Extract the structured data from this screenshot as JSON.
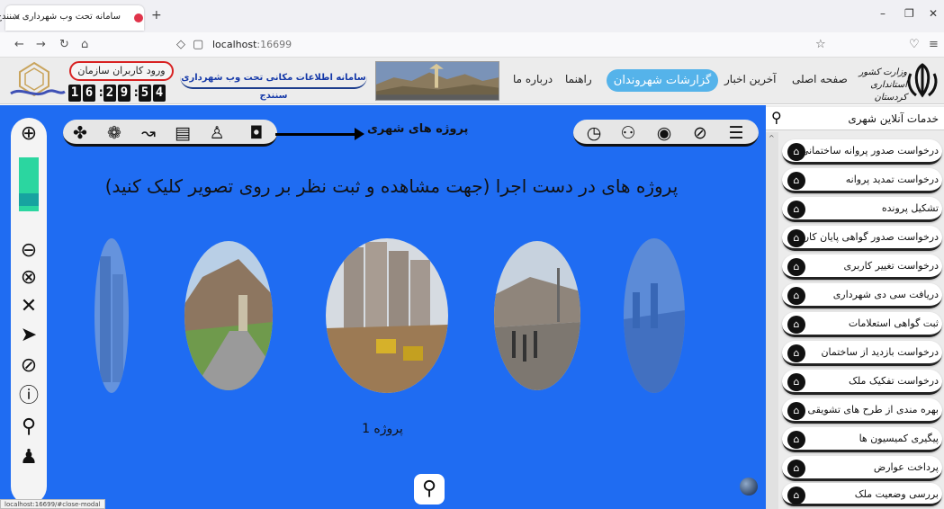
{
  "browser": {
    "tab_title": "سامانه تحت وب شهرداری سنندج",
    "tab_close": "×",
    "new_tab": "+",
    "url_host": "localhost",
    "url_port": ":16699",
    "win_min": "–",
    "win_max": "❐",
    "win_close": "✕"
  },
  "header": {
    "ministry": "وزارت کشور استانداری کردستان",
    "nav": {
      "home": "صفحه اصلی",
      "news": "آخرین اخبار",
      "reports": "گزارشات شهروندان",
      "guide": "راهنما",
      "about": "درباره ما"
    },
    "system_title": "سامانه اطلاعات مکانی تحت وب شهرداری سنندج",
    "login": "ورود کاربران سازمان",
    "clock": [
      "1",
      "6",
      ":",
      "2",
      "9",
      ":",
      "5",
      "4"
    ]
  },
  "main": {
    "projects_label": "پروژه های شهری",
    "headline": "پروژه های در دست اجرا (جهت مشاهده و ثبت نظر بر روی تصویر کلیک کنید)",
    "caption": "پروژه 1",
    "status_url": "localhost:16699/#close-modal"
  },
  "sidebar": {
    "title": "خدمات آنلاین شهری",
    "items": [
      "درخواست صدور پروانه ساختمانی",
      "درخواست تمدید پروانه",
      "تشکیل پرونده",
      "درخواست صدور گواهی پایان کار",
      "درخواست تغییر کاربری",
      "دریافت سی دی شهرداری",
      "ثبت گواهی استعلامات",
      "درخواست بازدید از ساختمان",
      "درخواست تفکیک ملک",
      "بهره مندی از طرح های تشویقی",
      "پیگیری کمیسیون ها",
      "پرداخت عوارض",
      "بررسی وضعیت ملک"
    ]
  },
  "colors": {
    "main_blue": "#1f6cf2",
    "nav_active": "#55b3ea",
    "login_border": "#d82222",
    "zoom_slider": "#2bd6a0"
  }
}
